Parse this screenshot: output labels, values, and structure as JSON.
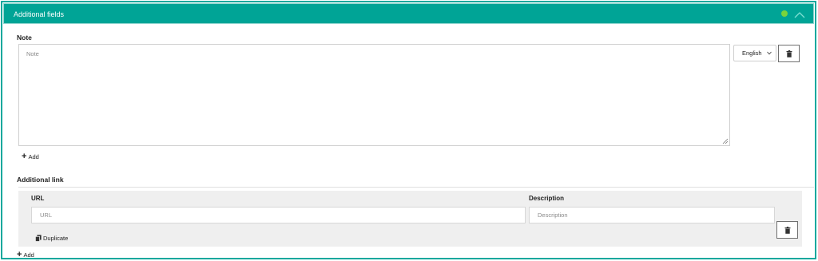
{
  "panel": {
    "title": "Additional fields",
    "status_color": "#7bd33c",
    "accent_color": "#00a496",
    "icons": [
      "status-dot",
      "chevron-up-icon"
    ]
  },
  "note": {
    "label": "Note",
    "placeholder": "Note",
    "value": "",
    "language": {
      "selected": "English"
    },
    "delete_icon": "trash-icon",
    "add_label": "Add"
  },
  "additional_link": {
    "label": "Additional link",
    "url_label": "URL",
    "url_placeholder": "URL",
    "description_label": "Description",
    "description_placeholder": "Description",
    "duplicate_label": "Duplicate",
    "duplicate_icon": "copy-icon",
    "delete_icon": "trash-icon",
    "add_label": "Add"
  }
}
